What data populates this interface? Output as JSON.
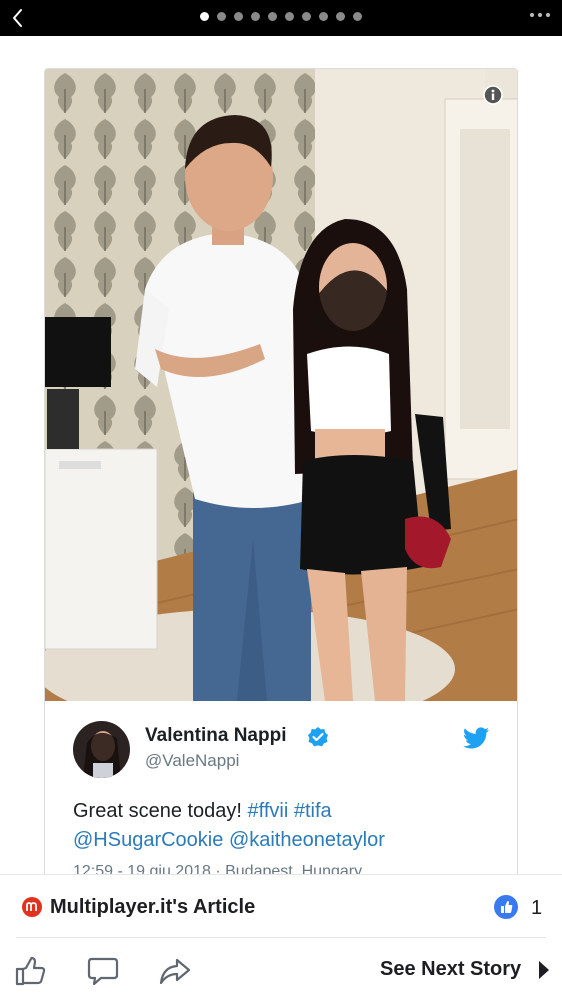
{
  "pager": {
    "total": 10,
    "active_index": 0
  },
  "tweet": {
    "author_name": "Valentina Nappi",
    "handle": "@ValeNappi",
    "text_plain": "Great scene today! ",
    "hashtags": [
      "#ffvii",
      "#tifa"
    ],
    "mentions": [
      "@HSugarCookie",
      "@kaitheonetaylor"
    ],
    "meta": "12:59 - 19 giu 2018 · Budapest, Hungary"
  },
  "source": {
    "title": "Multiplayer.it's Article",
    "likes": "1"
  },
  "actions": {
    "see_next": "See Next Story"
  },
  "colors": {
    "link": "#2b7bb9",
    "verified": "#1da1f2",
    "like": "#3b79f0",
    "source_logo": "#e0321f"
  },
  "icons": [
    "back-chevron-icon",
    "more-dots-icon",
    "info-icon",
    "verified-badge-icon",
    "twitter-bird-icon",
    "like-thumb-icon",
    "comment-icon",
    "share-icon",
    "play-arrow-icon"
  ]
}
